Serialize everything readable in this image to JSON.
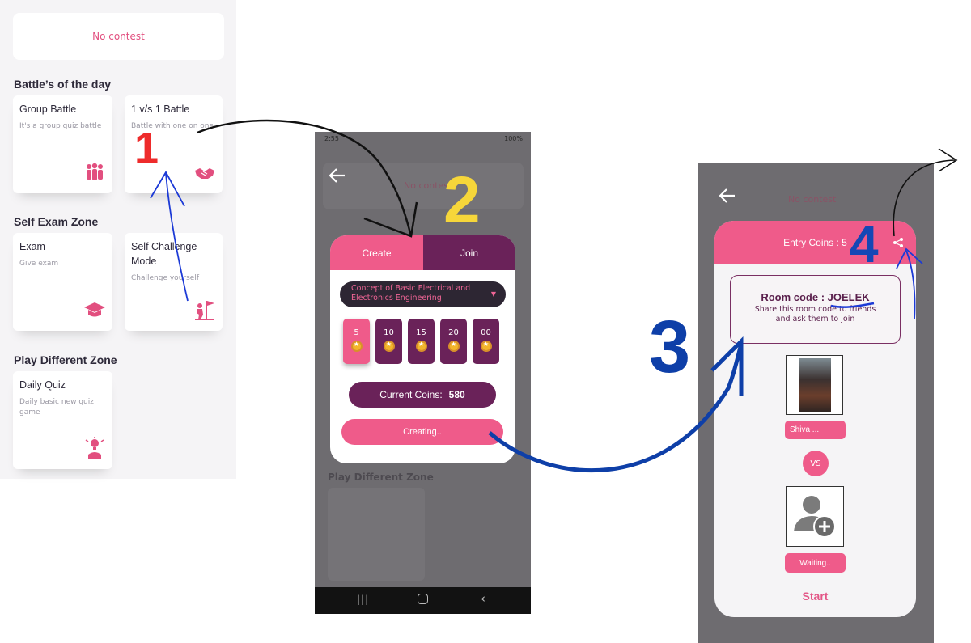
{
  "panel1": {
    "no_contest": "No contest",
    "sections": {
      "battles": "Battle’s of the day",
      "self_exam": "Self Exam Zone",
      "play_different": "Play Different Zone"
    },
    "cards": {
      "group_battle": {
        "title": "Group Battle",
        "subtitle": "It's a group quiz battle",
        "icon": "group-icon"
      },
      "one_v_one": {
        "title": "1 v/s 1 Battle",
        "subtitle": "Battle with one on one",
        "icon": "handshake-icon"
      },
      "exam": {
        "title": "Exam",
        "subtitle": "Give exam",
        "icon": "graduation-cap-icon"
      },
      "self_challenge": {
        "title": "Self Challenge Mode",
        "subtitle": "Challenge yourself",
        "icon": "flag-climber-icon"
      },
      "daily_quiz": {
        "title": "Daily Quiz",
        "subtitle": "Daily basic new quiz game",
        "icon": "lightbulb-person-icon"
      }
    }
  },
  "panel2": {
    "status": {
      "time": "2:55",
      "battery": "100%"
    },
    "tabs": {
      "create": "Create",
      "join": "Join"
    },
    "dropdown_value": "Concept of Basic Electrical and Electronics Engineering",
    "coin_options": [
      "5",
      "10",
      "15",
      "20",
      "00"
    ],
    "current_coins_label": "Current Coins:",
    "current_coins_value": "580",
    "creating_label": "Creating..",
    "background_text": {
      "no_contest": "No contest",
      "play_different": "Play Different Zone"
    }
  },
  "panel3": {
    "entry_coins": "Entry Coins : 5",
    "room_code_label": "Room code :",
    "room_code": "JOELEK",
    "share_text": "Share this room code to friends and ask them to join",
    "player_name": "Shiva ...",
    "vs": "VS",
    "waiting": "Waiting..",
    "start": "Start",
    "background_text": {
      "no_contest": "No contest"
    }
  },
  "annotations": {
    "one": "1",
    "two": "2",
    "three": "3",
    "four": "4"
  },
  "colors": {
    "primary": "#ef5b8a",
    "secondary": "#6a2259",
    "dark": "#2d2633",
    "step1": "#ee2b2b",
    "step2": "#f6d63a",
    "step3": "#0e3fa8",
    "step4": "#1547b5"
  }
}
